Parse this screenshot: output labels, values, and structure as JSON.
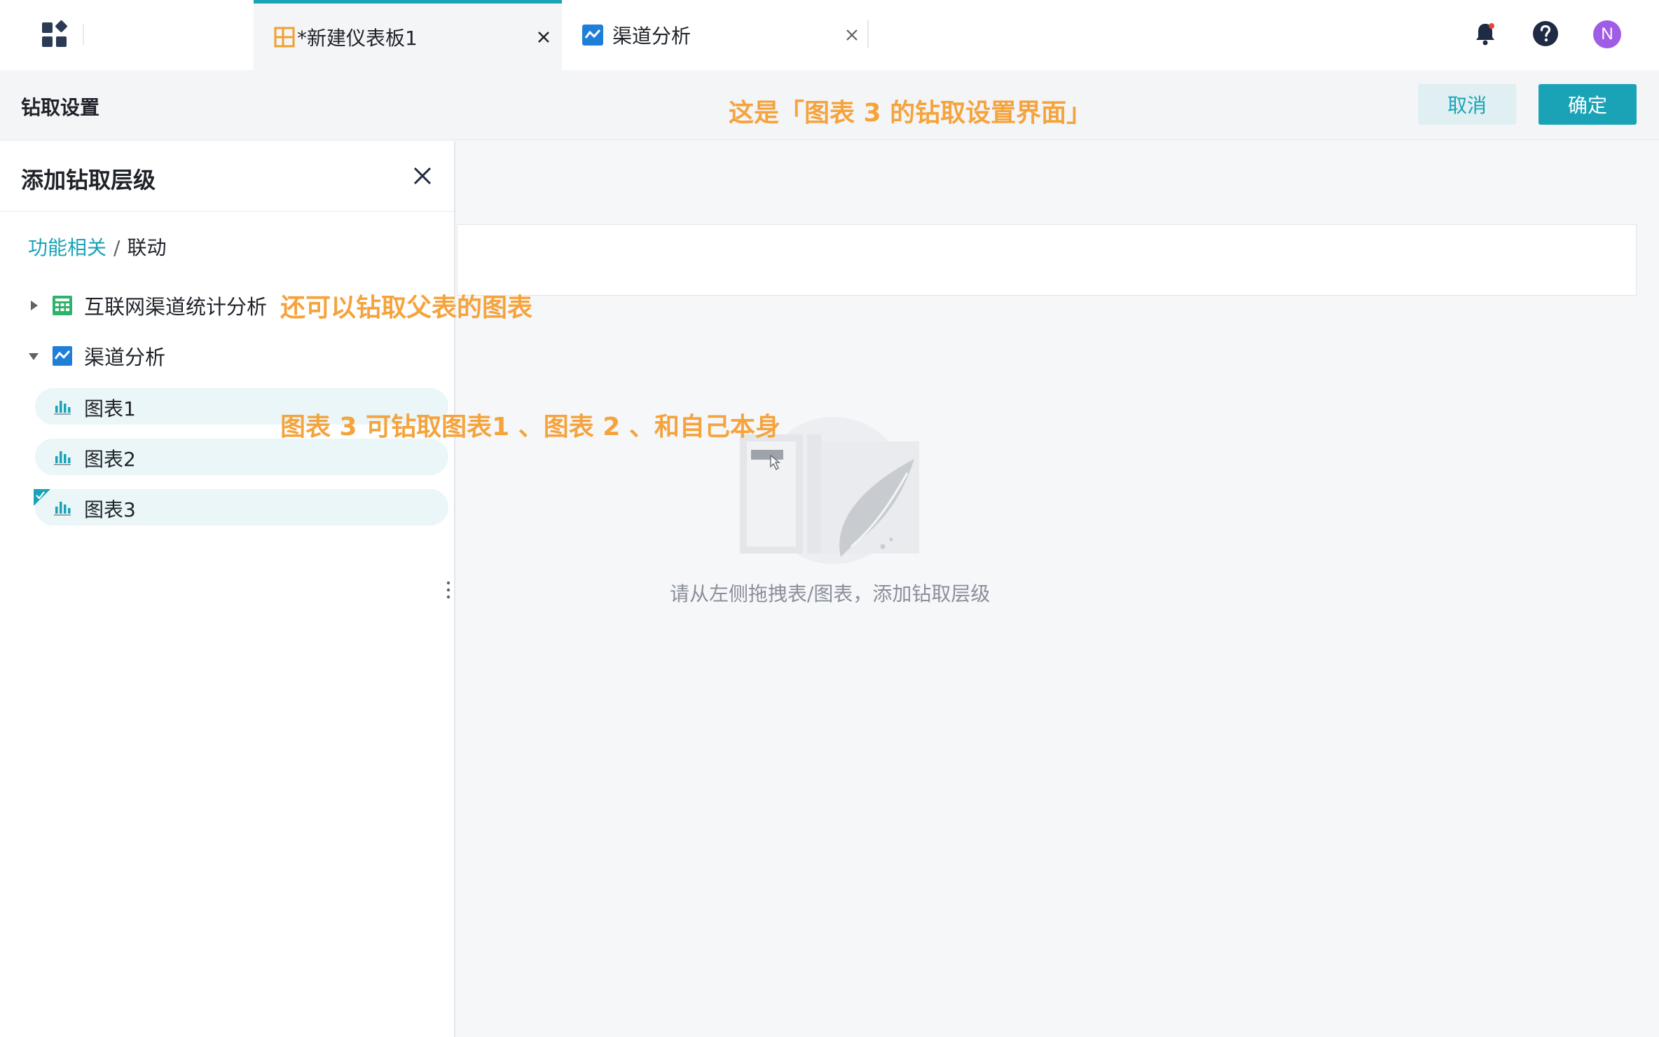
{
  "topbar": {
    "tabs": [
      {
        "label": "*新建仪表板1",
        "icon": "dashboard-icon",
        "active": true
      },
      {
        "label": "渠道分析",
        "icon": "analysis-icon",
        "active": false
      }
    ],
    "avatar_initial": "N",
    "accent_color": "#1aa3b7"
  },
  "subheader": {
    "title": "钻取设置",
    "cancel_label": "取消",
    "ok_label": "确定"
  },
  "annotations": {
    "header_note": "这是「图表 3 的钻取设置界面」",
    "parent_note": "还可以钻取父表的图表",
    "charts_note": "图表 3 可钻取图表1 、图表 2 、和自己本身",
    "color": "#f5a33c"
  },
  "panel": {
    "title": "添加钻取层级",
    "breadcrumb": {
      "link": "功能相关",
      "separator": "/",
      "current": "联动"
    },
    "tree": [
      {
        "label": "互联网渠道统计分析",
        "icon": "table-icon",
        "expanded": false
      },
      {
        "label": "渠道分析",
        "icon": "analysis-icon",
        "expanded": true,
        "children": [
          {
            "label": "图表1",
            "icon": "bar-chart-icon",
            "checked": false
          },
          {
            "label": "图表2",
            "icon": "bar-chart-icon",
            "checked": false
          },
          {
            "label": "图表3",
            "icon": "bar-chart-icon",
            "checked": true
          }
        ]
      }
    ]
  },
  "main": {
    "empty_text": "请从左侧拖拽表/图表，添加钻取层级"
  }
}
